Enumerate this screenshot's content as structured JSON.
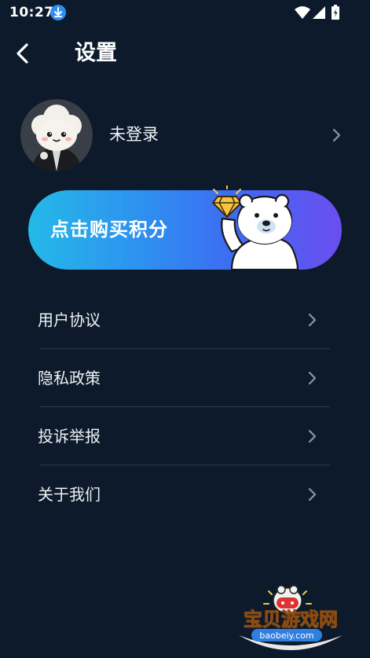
{
  "status_bar": {
    "time": "10:27",
    "icons": [
      "download-icon",
      "wifi-icon",
      "signal-icon",
      "battery-icon"
    ]
  },
  "header": {
    "back_icon": "chevron-left-icon",
    "title": "设置"
  },
  "profile": {
    "login_label": "未登录",
    "avatar": "cloud-character-avatar",
    "chevron_icon": "chevron-right-icon"
  },
  "banner": {
    "label": "点击购买积分",
    "illustration": "polar-bear-holding-diamond",
    "colors": {
      "start": "#24b9e8",
      "end": "#6a4ef0"
    }
  },
  "menu": {
    "items": [
      {
        "label": "用户协议"
      },
      {
        "label": "隐私政策"
      },
      {
        "label": "投诉举报"
      },
      {
        "label": "关于我们"
      }
    ]
  },
  "watermark": {
    "title": "宝贝游戏网",
    "url": "baobeiy.com"
  },
  "colors": {
    "background": "#0c1a2c",
    "divider": "#2a3a4c",
    "chevron": "#8a96a3"
  }
}
